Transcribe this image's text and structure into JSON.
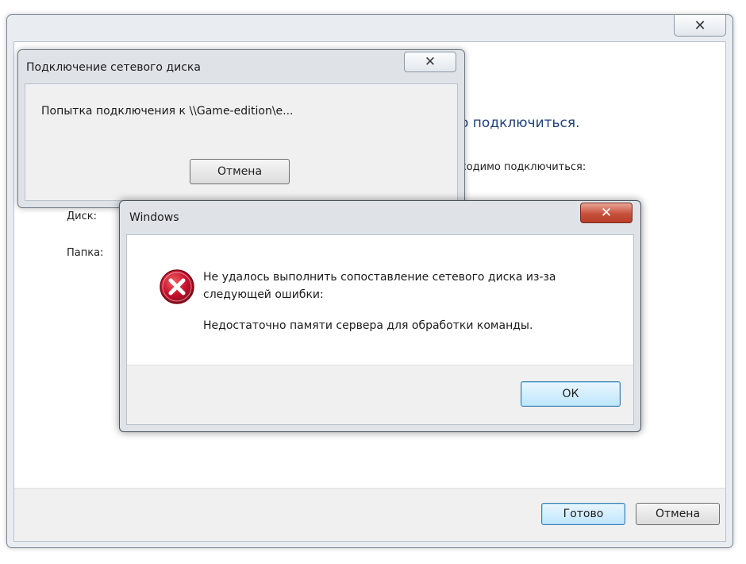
{
  "background_window": {
    "close_glyph": "✕",
    "heading": "о подключиться.",
    "subheading": "ходимо подключиться:",
    "drive_label": "Диск:",
    "folder_label": "Папка:",
    "done_button": "Готово",
    "cancel_button": "Отмена"
  },
  "progress_dialog": {
    "title": "Подключение сетевого диска",
    "close_glyph": "✕",
    "message": "Попытка подключения к \\\\Game-edition\\e...",
    "cancel_button": "Отмена"
  },
  "error_dialog": {
    "title": "Windows",
    "close_glyph": "✕",
    "icon": "error-icon",
    "message": "Не удалось выполнить сопоставление сетевого диска из-за следующей ошибки:",
    "detail": "Недостаточно памяти сервера для обработки команды.",
    "ok_button": "ОК"
  },
  "colors": {
    "heading_blue": "#1f3f7a",
    "error_red": "#c8102e",
    "close_red": "#c7513b",
    "default_button_border": "#3c7fb1"
  }
}
